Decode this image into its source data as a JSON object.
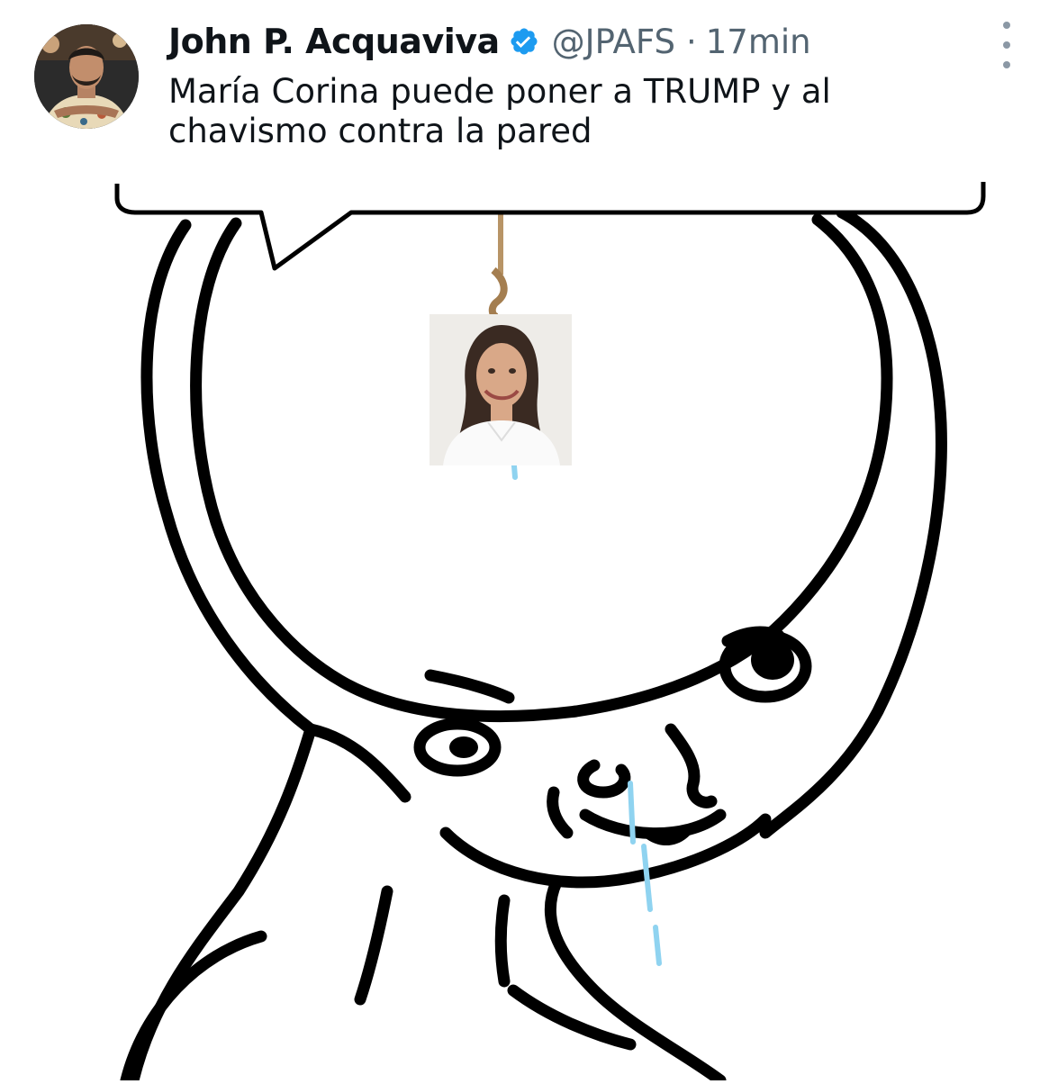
{
  "tweet": {
    "display_name": "John P. Acquaviva",
    "handle": "@JPAFS",
    "separator": "·",
    "time": "17min",
    "text": "María Corina puede poner a TRUMP y al\nchavismo contra la pared",
    "verified": true
  },
  "icons": {
    "verified": "verified-badge-icon",
    "more": "more-options-icon",
    "avatar": "profile-photo"
  },
  "colors": {
    "verified_blue": "#1d9bf0",
    "secondary_text": "#536471",
    "primary_text": "#0f1419",
    "drool": "#8fd3f0"
  }
}
